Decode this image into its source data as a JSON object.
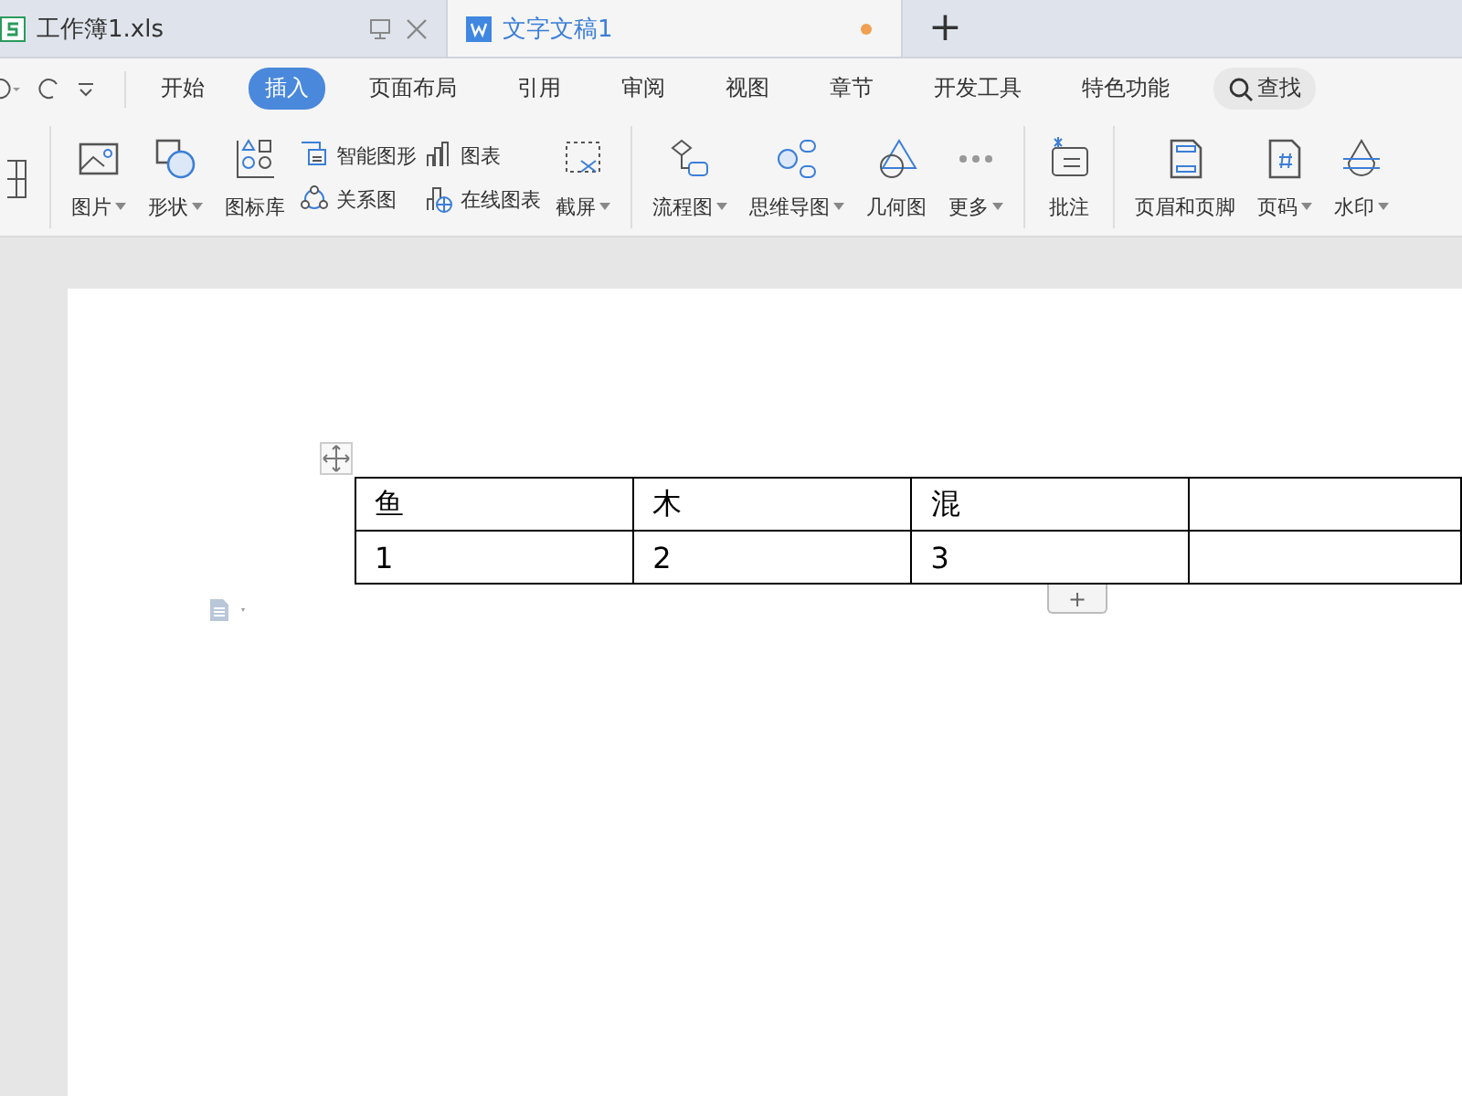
{
  "tabs": [
    {
      "label": "工作簿1.xls",
      "kind": "sheet",
      "selected": false,
      "unsaved": false
    },
    {
      "label": "文字文稿1",
      "kind": "writer",
      "selected": true,
      "unsaved": true
    }
  ],
  "new_tab": {
    "label": "+"
  },
  "menu": [
    {
      "label": "开始",
      "selected": false
    },
    {
      "label": "插入",
      "selected": true
    },
    {
      "label": "页面布局",
      "selected": false
    },
    {
      "label": "引用",
      "selected": false
    },
    {
      "label": "审阅",
      "selected": false
    },
    {
      "label": "视图",
      "selected": false
    },
    {
      "label": "章节",
      "selected": false
    },
    {
      "label": "开发工具",
      "selected": false
    },
    {
      "label": "特色功能",
      "selected": false
    }
  ],
  "search": {
    "label": "查找"
  },
  "toolbar": [
    [
      {
        "kind": "large",
        "label": "图片",
        "dropdown": true
      },
      {
        "kind": "large",
        "label": "形状",
        "dropdown": true
      },
      {
        "kind": "large",
        "label": "图标库",
        "dropdown": false
      },
      {
        "kind": "stack",
        "items": [
          {
            "label": "智能图形"
          },
          {
            "label": "关系图"
          }
        ]
      },
      {
        "kind": "stack",
        "items": [
          {
            "label": "图表"
          },
          {
            "label": "在线图表"
          }
        ]
      },
      {
        "kind": "large",
        "label": "截屏",
        "dropdown": true
      }
    ],
    [
      {
        "kind": "large",
        "label": "流程图",
        "dropdown": true
      },
      {
        "kind": "large",
        "label": "思维导图",
        "dropdown": true
      },
      {
        "kind": "large",
        "label": "几何图",
        "dropdown": false
      },
      {
        "kind": "large",
        "label": "更多",
        "dropdown": true
      }
    ],
    [
      {
        "kind": "large",
        "label": "批注",
        "dropdown": false
      }
    ],
    [
      {
        "kind": "large",
        "label": "页眉和页脚",
        "dropdown": false
      },
      {
        "kind": "large",
        "label": "页码",
        "dropdown": true
      },
      {
        "kind": "large",
        "label": "水印",
        "dropdown": true
      }
    ]
  ],
  "table": {
    "rows": [
      [
        "鱼",
        "木",
        "混",
        ""
      ],
      [
        "1",
        "2",
        "3",
        ""
      ]
    ]
  },
  "add_row": {
    "label": "+"
  }
}
